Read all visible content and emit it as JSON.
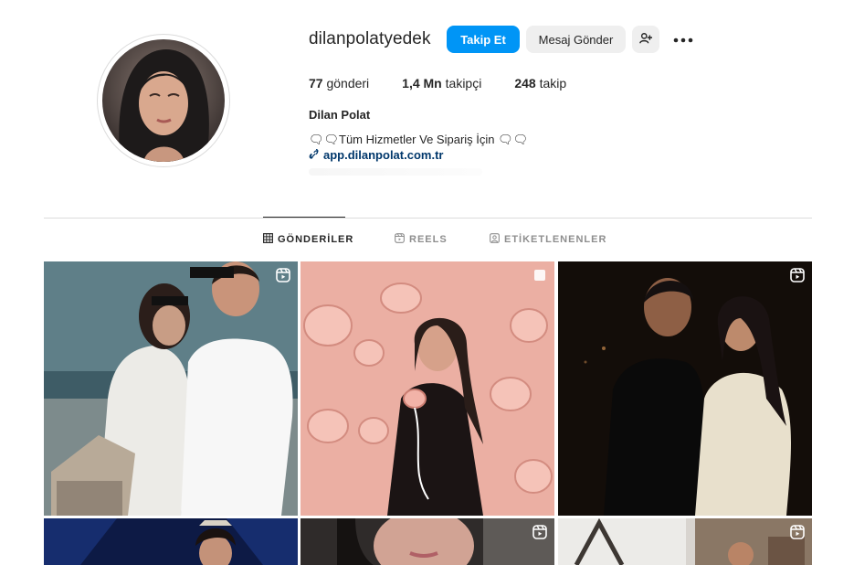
{
  "profile": {
    "username": "dilanpolatyedek",
    "follow_label": "Takip Et",
    "message_label": "Mesaj Gönder",
    "suggest_icon": "person-add-icon",
    "more_icon": "more-horizontal-icon",
    "stats": {
      "posts_value": "77",
      "posts_label": "gönderi",
      "followers_value": "1,4 Mn",
      "followers_label": "takipçi",
      "following_value": "248",
      "following_label": "takip"
    },
    "full_name": "Dilan Polat",
    "bio": "🗨🗨Tüm Hizmetler Ve Sipariş İçin 🗨🗨",
    "link": "app.dilanpolat.com.tr"
  },
  "tabs": [
    {
      "label": "GÖNDERİLER",
      "icon": "grid-icon",
      "active": true
    },
    {
      "label": "REELS",
      "icon": "reels-icon",
      "active": false
    },
    {
      "label": "ETİKETLENENLER",
      "icon": "tagged-icon",
      "active": false
    }
  ],
  "colors": {
    "accent": "#0095f6",
    "link": "#00376b",
    "text": "#262626",
    "muted": "#8e8e8e",
    "border": "#dbdbdb"
  },
  "posts": [
    {
      "type": "reel",
      "badge_icon": "reel-icon"
    },
    {
      "type": "carousel",
      "badge_icon": "multi-post-icon"
    },
    {
      "type": "reel",
      "badge_icon": "reel-icon"
    },
    {
      "type": "image",
      "badge_icon": ""
    },
    {
      "type": "reel",
      "badge_icon": "reel-icon"
    },
    {
      "type": "reel",
      "badge_icon": "reel-icon"
    }
  ]
}
